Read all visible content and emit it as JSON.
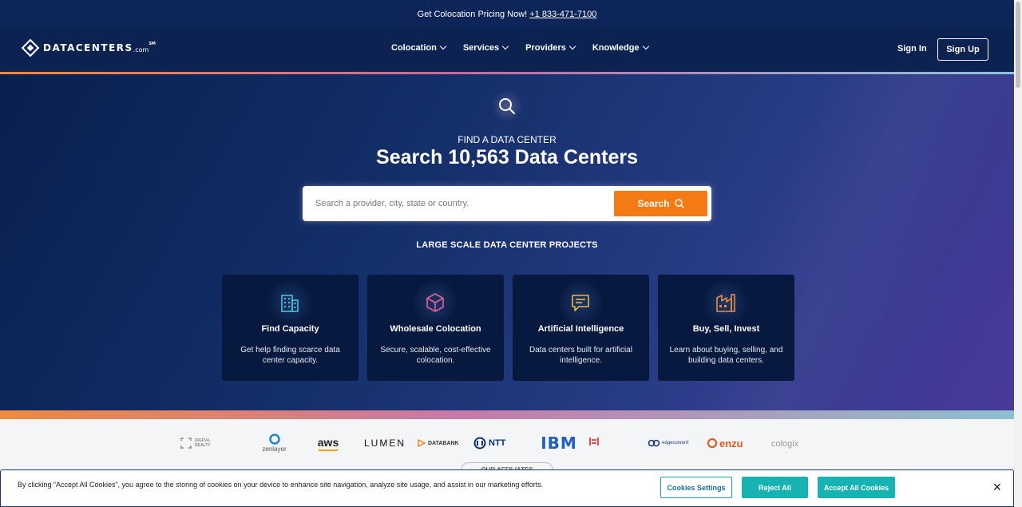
{
  "topbar": {
    "text": "Get Colocation Pricing Now!",
    "phone": "+1 833-471-7100"
  },
  "nav": {
    "logo_text": "DATACENTERS",
    "logo_suffix": ".com",
    "logo_mark": "SM",
    "items": [
      {
        "label": "Colocation"
      },
      {
        "label": "Services"
      },
      {
        "label": "Providers"
      },
      {
        "label": "Knowledge"
      }
    ],
    "sign_in": "Sign In",
    "sign_up": "Sign Up"
  },
  "hero": {
    "kicker": "FIND A DATA CENTER",
    "headline": "Search 10,563 Data Centers",
    "search_placeholder": "Search a provider, city, state or country.",
    "search_button": "Search",
    "section_title": "LARGE SCALE DATA CENTER PROJECTS",
    "cards": [
      {
        "icon": "building-icon",
        "title": "Find Capacity",
        "desc": "Get help finding scarce data center capacity."
      },
      {
        "icon": "cube-icon",
        "title": "Wholesale Colocation",
        "desc": "Secure, scalable, cost-effective colocation."
      },
      {
        "icon": "chat-icon",
        "title": "Artificial Intelligence",
        "desc": "Data centers built for artificial intelligence."
      },
      {
        "icon": "factory-icon",
        "title": "Buy, Sell, Invest",
        "desc": "Learn about buying, selling, and building data centers."
      }
    ]
  },
  "providers": {
    "logos": [
      "DIGITAL REALTY",
      "zenlayer",
      "aws",
      "LUMEN",
      "DATABANK",
      "NTT",
      "IBM",
      "edgeconneX",
      "enzu",
      "cologix"
    ],
    "affiliates_button": "OUR AFFILIATES"
  },
  "cookie": {
    "text": "By clicking “Accept All Cookies”, you agree to the storing of cookies on your device to enhance site navigation, analyze site usage, and assist in our marketing efforts.",
    "settings": "Cookies Settings",
    "reject": "Reject All",
    "accept": "Accept All Cookies",
    "close": "✕"
  },
  "colors": {
    "accent": "#f47a14",
    "teal": "#17b3b2",
    "navy": "#0c2250"
  }
}
